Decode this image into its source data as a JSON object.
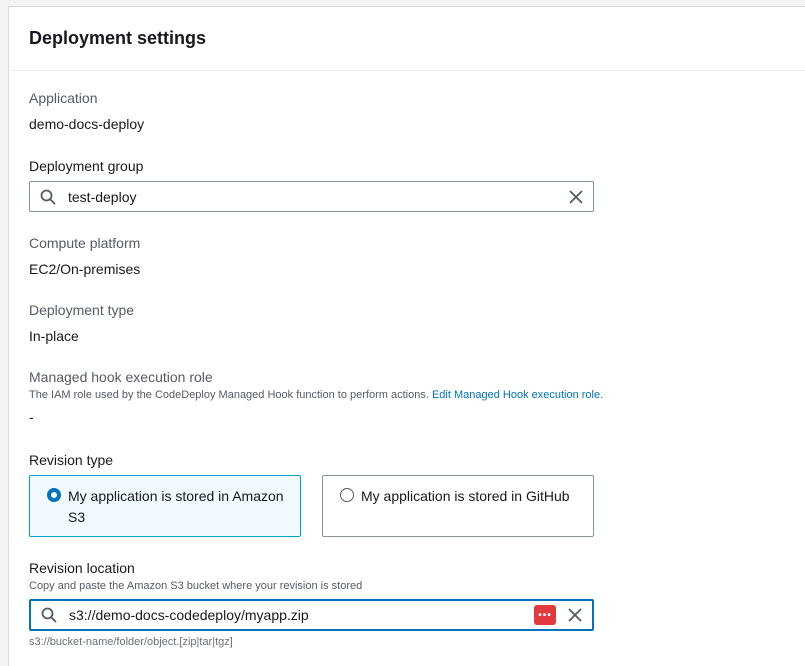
{
  "panel": {
    "title": "Deployment settings"
  },
  "application": {
    "label": "Application",
    "value": "demo-docs-deploy"
  },
  "deployment_group": {
    "label": "Deployment group",
    "value": "test-deploy"
  },
  "compute_platform": {
    "label": "Compute platform",
    "value": "EC2/On-premises"
  },
  "deployment_type": {
    "label": "Deployment type",
    "value": "In-place"
  },
  "managed_hook": {
    "label": "Managed hook execution role",
    "description": "The IAM role used by the CodeDeploy Managed Hook function to perform actions.",
    "link": "Edit Managed Hook execution role.",
    "value": "-"
  },
  "revision_type": {
    "label": "Revision type",
    "options": [
      {
        "label": "My application is stored in Amazon S3",
        "selected": true
      },
      {
        "label": "My application is stored in GitHub",
        "selected": false
      }
    ]
  },
  "revision_location": {
    "label": "Revision location",
    "description": "Copy and paste the Amazon S3 bucket where your revision is stored",
    "value": "s3://demo-docs-codedeploy/myapp.zip",
    "hint": "s3://bucket-name/folder/object.[zip|tar|tgz]",
    "password_icon_text": "•••"
  },
  "colors": {
    "accent": "#0073bb",
    "selected_bg": "#f1faff",
    "password_icon": "#e0393e"
  }
}
